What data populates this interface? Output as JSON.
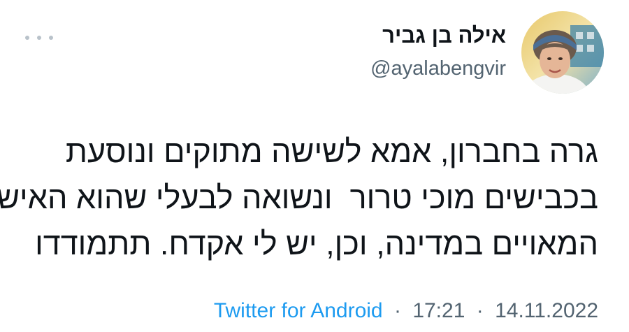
{
  "tweet": {
    "author": {
      "display_name": "אילה בן גביר",
      "handle": "@ayalabengvir"
    },
    "text_lines": [
      "גרה בחברון, אמא לשישה מתוקים ונוסעת",
      "בכבישים מוכי טרור  ונשואה לבעלי שהוא האיש",
      "המאויים במדינה, וכן, יש לי אקדח. תתמודדו"
    ],
    "meta": {
      "source": "Twitter for Android",
      "separator": "·",
      "time": "17:21",
      "date": "14.11.2022"
    }
  },
  "colors": {
    "text": "#0f1419",
    "secondary": "#536471",
    "link": "#1d9bf0",
    "more_dots": "#b9c2ca"
  },
  "icons": {
    "more": "more-horizontal-icon",
    "avatar": "profile-photo"
  }
}
